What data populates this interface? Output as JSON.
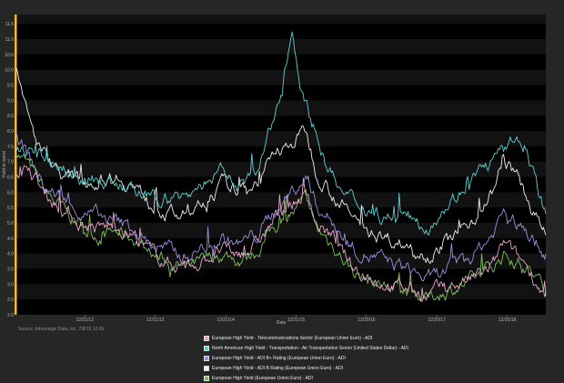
{
  "source_note": "Source: Advantage Data, Inc. 7/8/19 12:26",
  "colors": {
    "background": "#262626",
    "plot_background": "#000000",
    "plot_band": "#121212",
    "accent_left_bar": "#f2b83a"
  },
  "chart_data": {
    "type": "line",
    "title": "",
    "xlabel": "Date",
    "ylabel": "Yield to worst",
    "xlim": [
      "2012-01-01",
      "2019-07-08"
    ],
    "ylim": [
      2.0,
      11.8
    ],
    "y_ticks": [
      "2.0",
      "2.5",
      "3.0",
      "3.5",
      "4.0",
      "4.5",
      "5.0",
      "5.5",
      "6.0",
      "6.5",
      "7.0",
      "7.5",
      "8.0",
      "8.5",
      "9.0",
      "9.5",
      "10.0",
      "10.5",
      "11.0",
      "11.5"
    ],
    "x_ticks": [
      {
        "date": "2012-12-21",
        "label": "12/21/12"
      },
      {
        "date": "2013-12-21",
        "label": "12/21/13"
      },
      {
        "date": "2014-12-21",
        "label": "12/21/14"
      },
      {
        "date": "2015-12-21",
        "label": "12/21/15"
      },
      {
        "date": "2016-12-20",
        "label": "12/20/16"
      },
      {
        "date": "2017-12-20",
        "label": "12/20/17"
      },
      {
        "date": "2018-12-20",
        "label": "12/20/18"
      }
    ],
    "grid": "horizontal bands",
    "legend_position": "bottom",
    "series": [
      {
        "name": "European High Yield - Telecommunications Sector (European Union Euro) - ADI",
        "color": "#e8a6cd",
        "points": [
          [
            "2012-01-01",
            6.6
          ],
          [
            "2012-03-01",
            6.9
          ],
          [
            "2012-06-01",
            5.9
          ],
          [
            "2012-09-01",
            5.4
          ],
          [
            "2012-12-01",
            5.0
          ],
          [
            "2013-03-01",
            4.8
          ],
          [
            "2013-06-01",
            4.9
          ],
          [
            "2013-09-01",
            4.6
          ],
          [
            "2013-12-01",
            4.0
          ],
          [
            "2014-03-01",
            3.7
          ],
          [
            "2014-06-01",
            3.6
          ],
          [
            "2014-09-01",
            3.8
          ],
          [
            "2014-12-01",
            4.1
          ],
          [
            "2015-03-01",
            3.9
          ],
          [
            "2015-06-01",
            4.3
          ],
          [
            "2015-09-01",
            5.1
          ],
          [
            "2015-12-01",
            5.6
          ],
          [
            "2016-02-10",
            6.0
          ],
          [
            "2016-04-01",
            5.0
          ],
          [
            "2016-07-01",
            4.5
          ],
          [
            "2016-10-01",
            3.6
          ],
          [
            "2016-12-01",
            3.3
          ],
          [
            "2017-03-01",
            3.1
          ],
          [
            "2017-06-01",
            2.9
          ],
          [
            "2017-09-01",
            2.8
          ],
          [
            "2017-11-01",
            2.6
          ],
          [
            "2018-01-01",
            2.8
          ],
          [
            "2018-04-01",
            3.0
          ],
          [
            "2018-07-01",
            3.2
          ],
          [
            "2018-10-01",
            3.5
          ],
          [
            "2018-12-01",
            4.3
          ],
          [
            "2019-02-01",
            3.9
          ],
          [
            "2019-04-01",
            3.6
          ],
          [
            "2019-06-01",
            3.0
          ],
          [
            "2019-07-08",
            2.6
          ]
        ]
      },
      {
        "name": "North American High Yield - Transportation - Air Transportation Sector (United States Dollar) - ADI",
        "color": "#5fd0d0",
        "points": [
          [
            "2012-01-01",
            7.2
          ],
          [
            "2012-03-01",
            7.4
          ],
          [
            "2012-06-01",
            7.1
          ],
          [
            "2012-09-01",
            6.8
          ],
          [
            "2012-12-01",
            6.5
          ],
          [
            "2013-03-01",
            6.4
          ],
          [
            "2013-06-01",
            6.3
          ],
          [
            "2013-09-01",
            6.0
          ],
          [
            "2013-12-01",
            5.7
          ],
          [
            "2014-03-01",
            5.8
          ],
          [
            "2014-06-01",
            5.9
          ],
          [
            "2014-09-01",
            6.3
          ],
          [
            "2014-12-01",
            6.6
          ],
          [
            "2015-03-01",
            6.2
          ],
          [
            "2015-06-01",
            6.6
          ],
          [
            "2015-09-01",
            8.4
          ],
          [
            "2015-12-01",
            11.3
          ],
          [
            "2016-02-01",
            9.0
          ],
          [
            "2016-04-01",
            8.0
          ],
          [
            "2016-06-01",
            6.8
          ],
          [
            "2016-09-01",
            5.8
          ],
          [
            "2016-12-01",
            5.6
          ],
          [
            "2017-03-01",
            5.3
          ],
          [
            "2017-06-01",
            5.2
          ],
          [
            "2017-09-01",
            5.1
          ],
          [
            "2017-11-01",
            4.9
          ],
          [
            "2018-01-01",
            5.4
          ],
          [
            "2018-04-01",
            5.9
          ],
          [
            "2018-07-01",
            6.5
          ],
          [
            "2018-10-01",
            7.0
          ],
          [
            "2018-12-01",
            7.3
          ],
          [
            "2019-02-01",
            7.7
          ],
          [
            "2019-04-01",
            7.5
          ],
          [
            "2019-06-01",
            6.0
          ],
          [
            "2019-07-08",
            5.3
          ]
        ]
      },
      {
        "name": "European High Yield - ADI B+ Rating (European Union Euro) - ADI",
        "color": "#9a91e0",
        "points": [
          [
            "2012-01-01",
            8.0
          ],
          [
            "2012-03-01",
            7.2
          ],
          [
            "2012-06-01",
            6.1
          ],
          [
            "2012-09-01",
            5.8
          ],
          [
            "2012-12-01",
            5.3
          ],
          [
            "2013-03-01",
            5.2
          ],
          [
            "2013-06-01",
            5.0
          ],
          [
            "2013-09-01",
            4.8
          ],
          [
            "2013-12-01",
            4.3
          ],
          [
            "2014-03-01",
            4.1
          ],
          [
            "2014-06-01",
            3.9
          ],
          [
            "2014-09-01",
            4.2
          ],
          [
            "2014-12-01",
            4.5
          ],
          [
            "2015-03-01",
            4.3
          ],
          [
            "2015-06-01",
            4.6
          ],
          [
            "2015-09-01",
            5.4
          ],
          [
            "2015-12-01",
            6.0
          ],
          [
            "2016-02-10",
            6.5
          ],
          [
            "2016-04-01",
            5.6
          ],
          [
            "2016-07-01",
            5.0
          ],
          [
            "2016-10-01",
            4.3
          ],
          [
            "2016-12-01",
            4.0
          ],
          [
            "2017-03-01",
            3.8
          ],
          [
            "2017-06-01",
            3.6
          ],
          [
            "2017-09-01",
            3.4
          ],
          [
            "2017-11-01",
            3.1
          ],
          [
            "2018-01-01",
            3.3
          ],
          [
            "2018-04-01",
            3.6
          ],
          [
            "2018-07-01",
            4.0
          ],
          [
            "2018-10-01",
            4.6
          ],
          [
            "2018-12-01",
            5.4
          ],
          [
            "2019-02-01",
            5.0
          ],
          [
            "2019-04-01",
            4.7
          ],
          [
            "2019-06-01",
            4.3
          ],
          [
            "2019-07-08",
            4.0
          ]
        ]
      },
      {
        "name": "European High Yield - ADI B Rating (European Union Euro) - ADI",
        "color": "#eeeeee",
        "points": [
          [
            "2012-01-01",
            10.2
          ],
          [
            "2012-02-01",
            9.0
          ],
          [
            "2012-04-01",
            7.8
          ],
          [
            "2012-06-01",
            7.2
          ],
          [
            "2012-09-01",
            6.6
          ],
          [
            "2012-12-01",
            6.3
          ],
          [
            "2013-03-01",
            6.4
          ],
          [
            "2013-06-01",
            6.6
          ],
          [
            "2013-09-01",
            6.2
          ],
          [
            "2013-12-01",
            5.6
          ],
          [
            "2014-03-01",
            5.3
          ],
          [
            "2014-06-01",
            5.2
          ],
          [
            "2014-09-01",
            5.6
          ],
          [
            "2014-12-01",
            6.2
          ],
          [
            "2015-03-01",
            6.0
          ],
          [
            "2015-06-01",
            6.4
          ],
          [
            "2015-09-01",
            7.2
          ],
          [
            "2015-12-01",
            7.6
          ],
          [
            "2016-02-10",
            8.0
          ],
          [
            "2016-04-01",
            6.8
          ],
          [
            "2016-07-01",
            6.0
          ],
          [
            "2016-10-01",
            5.2
          ],
          [
            "2016-12-01",
            4.9
          ],
          [
            "2017-03-01",
            4.6
          ],
          [
            "2017-06-01",
            4.4
          ],
          [
            "2017-09-01",
            4.2
          ],
          [
            "2017-11-01",
            4.0
          ],
          [
            "2018-01-01",
            4.2
          ],
          [
            "2018-04-01",
            4.6
          ],
          [
            "2018-07-01",
            5.2
          ],
          [
            "2018-10-01",
            6.0
          ],
          [
            "2018-12-01",
            7.0
          ],
          [
            "2019-02-01",
            6.6
          ],
          [
            "2019-04-01",
            5.8
          ],
          [
            "2019-06-01",
            5.0
          ],
          [
            "2019-07-08",
            4.6
          ]
        ]
      },
      {
        "name": "European High Yield (European Union Euro) - ADI",
        "color": "#7fc25a",
        "points": [
          [
            "2012-01-01",
            7.4
          ],
          [
            "2012-03-01",
            6.9
          ],
          [
            "2012-06-01",
            6.0
          ],
          [
            "2012-09-01",
            5.4
          ],
          [
            "2012-12-01",
            4.9
          ],
          [
            "2013-03-01",
            4.6
          ],
          [
            "2013-06-01",
            4.7
          ],
          [
            "2013-09-01",
            4.5
          ],
          [
            "2013-12-01",
            4.0
          ],
          [
            "2014-03-01",
            3.7
          ],
          [
            "2014-06-01",
            3.5
          ],
          [
            "2014-09-01",
            3.7
          ],
          [
            "2014-12-01",
            4.0
          ],
          [
            "2015-03-01",
            3.8
          ],
          [
            "2015-06-01",
            4.1
          ],
          [
            "2015-09-01",
            4.9
          ],
          [
            "2015-12-01",
            5.3
          ],
          [
            "2016-02-10",
            5.7
          ],
          [
            "2016-04-01",
            4.8
          ],
          [
            "2016-07-01",
            4.3
          ],
          [
            "2016-10-01",
            3.5
          ],
          [
            "2016-12-01",
            3.2
          ],
          [
            "2017-03-01",
            3.0
          ],
          [
            "2017-06-01",
            2.8
          ],
          [
            "2017-09-01",
            2.7
          ],
          [
            "2017-11-01",
            2.5
          ],
          [
            "2018-01-01",
            2.7
          ],
          [
            "2018-04-01",
            2.9
          ],
          [
            "2018-07-01",
            3.1
          ],
          [
            "2018-10-01",
            3.5
          ],
          [
            "2018-12-01",
            4.0
          ],
          [
            "2019-02-01",
            3.8
          ],
          [
            "2019-04-01",
            3.5
          ],
          [
            "2019-06-01",
            3.1
          ],
          [
            "2019-07-08",
            2.8
          ]
        ]
      }
    ]
  }
}
